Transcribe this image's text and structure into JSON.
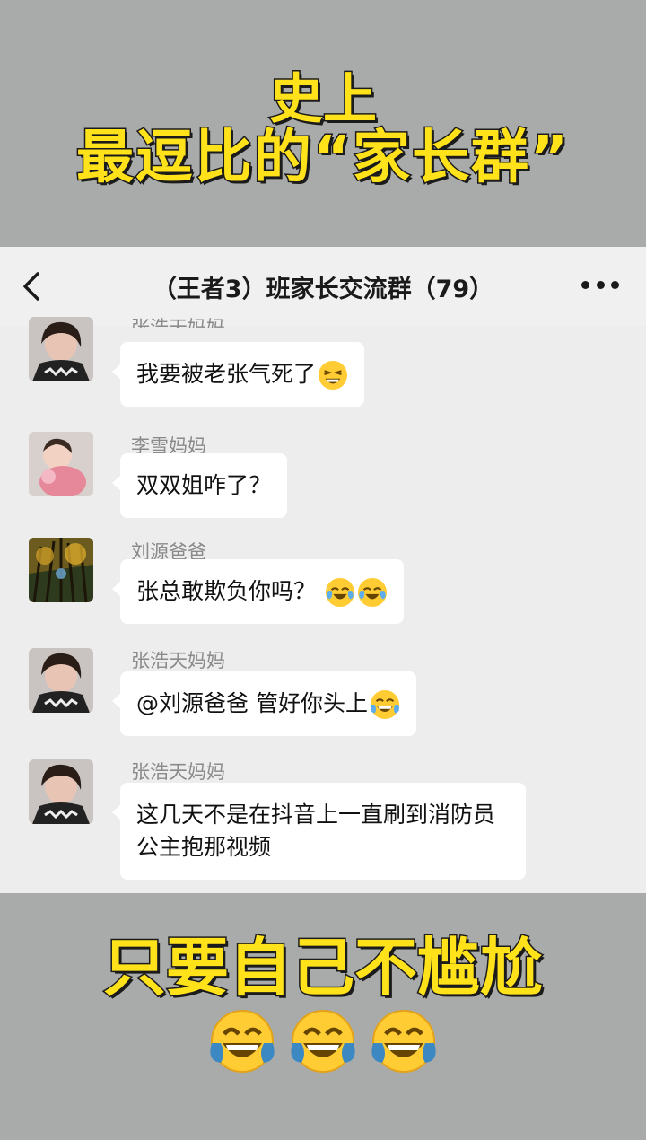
{
  "captions": {
    "top_line1": "史上",
    "top_line2": "最逗比的“家长群”",
    "bottom": "只要自己不尴尬"
  },
  "header": {
    "title": "（王者3）班家长交流群（79）",
    "back_icon": "chevron-left-icon",
    "more_icon": "more-dots-icon"
  },
  "messages": [
    {
      "sender": "张浩天妈妈",
      "text": "我要被老张气死了",
      "emojis": [
        "tired-face"
      ]
    },
    {
      "sender": "李雪妈妈",
      "text": "双双姐咋了？",
      "emojis": []
    },
    {
      "sender": "刘源爸爸",
      "text": "张总敢欺负你吗？ ",
      "emojis": [
        "face-with-tears",
        "face-with-tears"
      ]
    },
    {
      "sender": "张浩天妈妈",
      "text": "@刘源爸爸  管好你头上",
      "emojis": [
        "laughing-tears"
      ]
    },
    {
      "sender": "张浩天妈妈",
      "text": "这几天不是在抖音上一直刷到消防员公主抱那视频",
      "emojis": []
    }
  ],
  "colors": {
    "caption_yellow": "#ffe21a",
    "chat_bg": "#ededed",
    "bubble_bg": "#ffffff",
    "page_bg": "#a9abaa"
  }
}
